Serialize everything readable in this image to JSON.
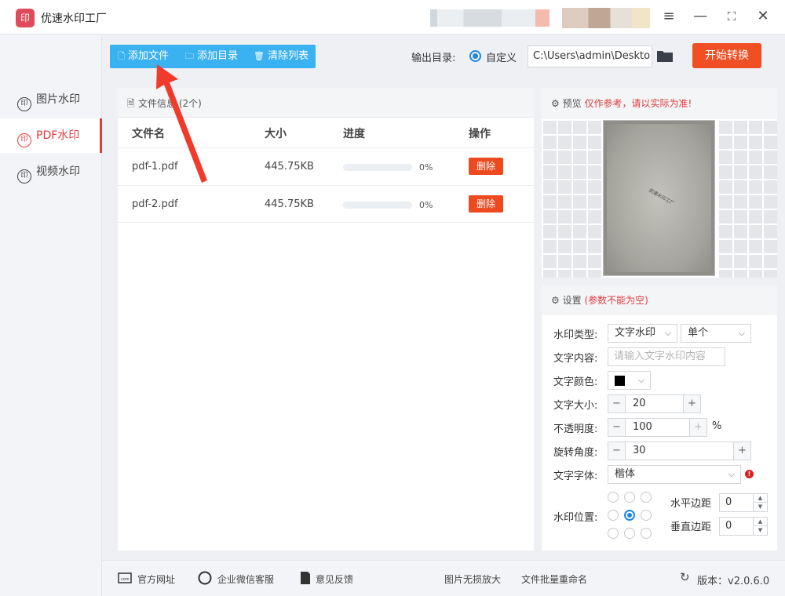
{
  "app": {
    "title": "优速水印工厂",
    "logo_text": "印"
  },
  "window_controls": {
    "menu": "≡",
    "minimize": "—",
    "maximize": "⛶",
    "close": "✕"
  },
  "sidebar": {
    "items": [
      {
        "label": "图片水印",
        "icon": "印",
        "active": false
      },
      {
        "label": "PDF水印",
        "icon": "印",
        "active": true
      },
      {
        "label": "视频水印",
        "icon": "印",
        "active": false
      }
    ]
  },
  "toolbar": {
    "add_file": "添加文件",
    "add_dir": "添加目录",
    "clear_list": "清除列表"
  },
  "output": {
    "label": "输出目录:",
    "option": "自定义",
    "path": "C:\\Users\\admin\\Deskto",
    "start": "开始转换"
  },
  "files": {
    "header": "文件信息 (2个)",
    "columns": [
      "文件名",
      "大小",
      "进度",
      "操作"
    ],
    "rows": [
      {
        "name": "pdf-1.pdf",
        "size": "445.75KB",
        "progress": "0%",
        "action": "删除"
      },
      {
        "name": "pdf-2.pdf",
        "size": "445.75KB",
        "progress": "0%",
        "action": "删除"
      }
    ]
  },
  "preview": {
    "title": "预览",
    "note": "仅作参考，请以实际为准!",
    "watermark_sample": "优速水印工厂"
  },
  "settings": {
    "title": "设置",
    "note": "(参数不能为空)",
    "type_label": "水印类型:",
    "type_value": "文字水印",
    "mode_value": "单个",
    "content_label": "文字内容:",
    "content_placeholder": "请输入文字水印内容",
    "color_label": "文字颜色:",
    "color_value": "#000000",
    "size_label": "文字大小:",
    "size_value": "20",
    "opacity_label": "不透明度:",
    "opacity_value": "100",
    "opacity_unit": "%",
    "rotate_label": "旋转角度:",
    "rotate_value": "30",
    "font_label": "文字字体:",
    "font_value": "楷体",
    "position_label": "水印位置:",
    "h_margin_label": "水平边距",
    "h_margin_value": "0",
    "v_margin_label": "垂直边距",
    "v_margin_value": "0"
  },
  "footer": {
    "site": "官方网址",
    "wechat": "企业微信客服",
    "feedback": "意见反馈",
    "upscale": "图片无损放大",
    "rename": "文件批量重命名",
    "version": "版本：v2.0.6.0"
  },
  "colors": {
    "accent_red": "#e03b3b",
    "toolbar_blue": "#3ab1f0",
    "start_orange": "#f04e23",
    "radio_blue": "#1e88e5"
  }
}
